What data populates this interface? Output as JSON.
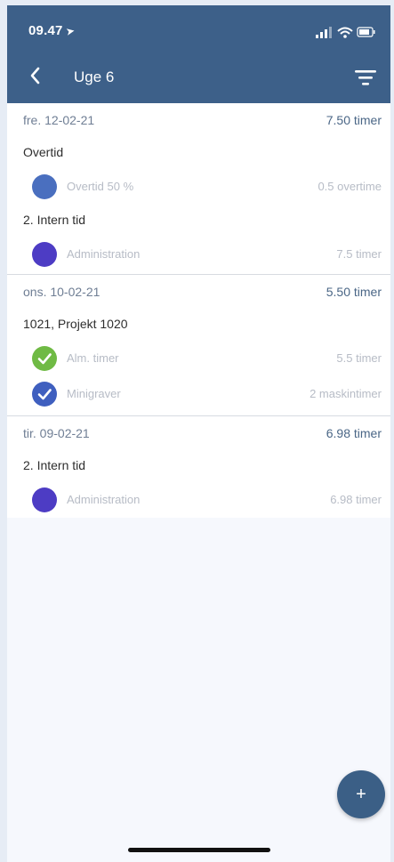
{
  "status_bar": {
    "time": "09.47",
    "location_arrow": "location-arrow-icon"
  },
  "header": {
    "title": "Uge 6",
    "back_icon": "chevron-left-icon",
    "filter_icon": "filter-icon"
  },
  "colors": {
    "header_bg": "#3d6089",
    "blue_dot": "#4a6fbf",
    "purple_dot": "#4d3cc4",
    "green_check": "#6fba44",
    "blue_check": "#3f5fbf",
    "fab": "#3b5f86"
  },
  "days": [
    {
      "date": "fre. 12-02-21",
      "total": "7.50 timer",
      "groups": [
        {
          "label": "Overtid",
          "entries": [
            {
              "name": "Overtid 50 %",
              "amount": "0.5 overtime",
              "icon": "blue-dot-icon"
            }
          ]
        },
        {
          "label": "2. Intern tid",
          "entries": [
            {
              "name": "Administration",
              "amount": "7.5 timer",
              "icon": "purple-dot-icon"
            }
          ]
        }
      ]
    },
    {
      "date": "ons. 10-02-21",
      "total": "5.50 timer",
      "groups": [
        {
          "label": "1021, Projekt 1020",
          "entries": [
            {
              "name": "Alm. timer",
              "amount": "5.5 timer",
              "icon": "green-check-icon"
            },
            {
              "name": "Minigraver",
              "amount": "2 maskintimer",
              "icon": "blue-check-icon"
            }
          ]
        }
      ]
    },
    {
      "date": "tir. 09-02-21",
      "total": "6.98 timer",
      "groups": [
        {
          "label": "2. Intern tid",
          "entries": [
            {
              "name": "Administration",
              "amount": "6.98 timer",
              "icon": "purple-dot-icon"
            }
          ]
        }
      ]
    }
  ],
  "fab": {
    "label": "+"
  }
}
